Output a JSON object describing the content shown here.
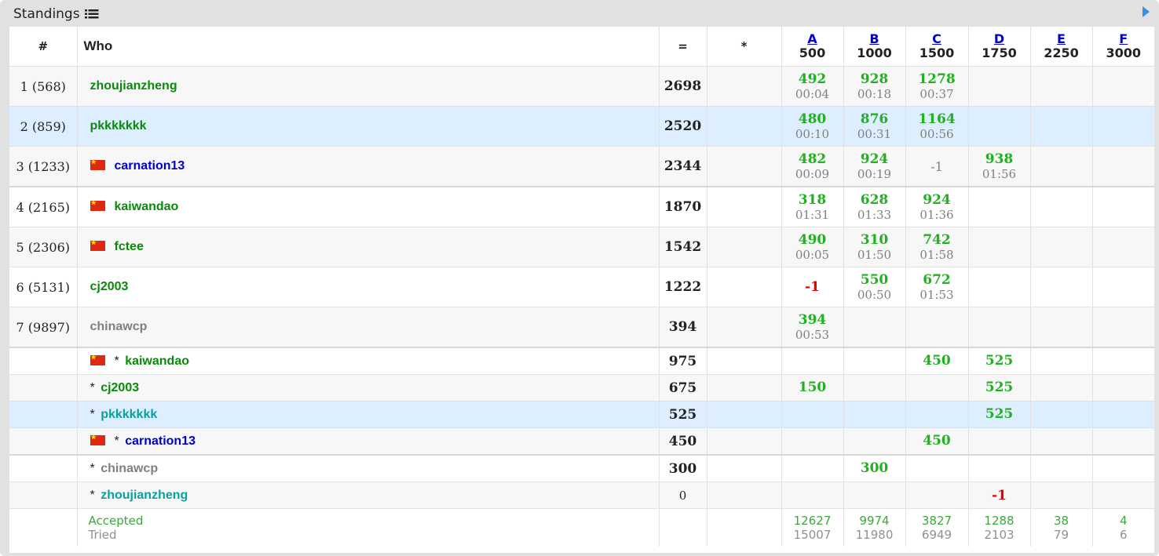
{
  "caption": {
    "title": "Standings"
  },
  "headers": {
    "rank": "#",
    "who": "Who",
    "points": "=",
    "penalty": "*"
  },
  "problems": [
    {
      "letter": "A",
      "value": "500"
    },
    {
      "letter": "B",
      "value": "1000"
    },
    {
      "letter": "C",
      "value": "1500"
    },
    {
      "letter": "D",
      "value": "1750"
    },
    {
      "letter": "E",
      "value": "2250"
    },
    {
      "letter": "F",
      "value": "3000"
    }
  ],
  "rows": [
    {
      "rank": "1 (568)",
      "who": "zhoujianzheng",
      "color": "green",
      "flag": false,
      "points": "2698",
      "virtual": false,
      "hl": false,
      "cells": [
        {
          "score": "492",
          "time": "00:04"
        },
        {
          "score": "928",
          "time": "00:18"
        },
        {
          "score": "1278",
          "time": "00:37"
        },
        null,
        null,
        null
      ]
    },
    {
      "rank": "2 (859)",
      "who": "pkkkkkkk",
      "color": "green",
      "flag": false,
      "points": "2520",
      "virtual": false,
      "hl": true,
      "cells": [
        {
          "score": "480",
          "time": "00:10"
        },
        {
          "score": "876",
          "time": "00:31"
        },
        {
          "score": "1164",
          "time": "00:56"
        },
        null,
        null,
        null
      ]
    },
    {
      "rank": "3 (1233)",
      "who": "carnation13",
      "color": "blue",
      "flag": true,
      "points": "2344",
      "virtual": false,
      "hl": false,
      "cells": [
        {
          "score": "482",
          "time": "00:09"
        },
        {
          "score": "924",
          "time": "00:19"
        },
        {
          "neg": "-1"
        },
        {
          "score": "938",
          "time": "01:56"
        },
        null,
        null
      ]
    },
    {
      "rank": "4 (2165)",
      "who": "kaiwandao",
      "color": "green",
      "flag": true,
      "points": "1870",
      "virtual": false,
      "hl": false,
      "cells": [
        {
          "score": "318",
          "time": "01:31"
        },
        {
          "score": "628",
          "time": "01:33"
        },
        {
          "score": "924",
          "time": "01:36"
        },
        null,
        null,
        null
      ]
    },
    {
      "rank": "5 (2306)",
      "who": "fctee",
      "color": "green",
      "flag": true,
      "points": "1542",
      "virtual": false,
      "hl": false,
      "cells": [
        {
          "score": "490",
          "time": "00:05"
        },
        {
          "score": "310",
          "time": "01:50"
        },
        {
          "score": "742",
          "time": "01:58"
        },
        null,
        null,
        null
      ]
    },
    {
      "rank": "6 (5131)",
      "who": "cj2003",
      "color": "green",
      "flag": false,
      "points": "1222",
      "virtual": false,
      "hl": false,
      "cells": [
        {
          "negred": "-1"
        },
        {
          "score": "550",
          "time": "00:50"
        },
        {
          "score": "672",
          "time": "01:53"
        },
        null,
        null,
        null
      ]
    },
    {
      "rank": "7 (9897)",
      "who": "chinawcp",
      "color": "gray",
      "flag": false,
      "points": "394",
      "virtual": false,
      "hl": false,
      "cells": [
        {
          "score": "394",
          "time": "00:53"
        },
        null,
        null,
        null,
        null,
        null
      ]
    },
    {
      "rank": "",
      "who": "kaiwandao",
      "color": "green",
      "flag": true,
      "points": "975",
      "virtual": true,
      "hl": false,
      "cells": [
        null,
        null,
        {
          "score": "450"
        },
        {
          "score": "525"
        },
        null,
        null
      ]
    },
    {
      "rank": "",
      "who": "cj2003",
      "color": "green",
      "flag": false,
      "points": "675",
      "virtual": true,
      "hl": false,
      "cells": [
        {
          "score": "150"
        },
        null,
        null,
        {
          "score": "525"
        },
        null,
        null
      ]
    },
    {
      "rank": "",
      "who": "pkkkkkkk",
      "color": "teal",
      "flag": false,
      "points": "525",
      "virtual": true,
      "hl": true,
      "cells": [
        null,
        null,
        null,
        {
          "score": "525"
        },
        null,
        null
      ]
    },
    {
      "rank": "",
      "who": "carnation13",
      "color": "blue",
      "flag": true,
      "points": "450",
      "virtual": true,
      "hl": false,
      "cells": [
        null,
        null,
        {
          "score": "450"
        },
        null,
        null,
        null
      ]
    },
    {
      "rank": "",
      "who": "chinawcp",
      "color": "gray",
      "flag": false,
      "points": "300",
      "virtual": true,
      "hl": false,
      "cells": [
        null,
        {
          "score": "300"
        },
        null,
        null,
        null,
        null
      ]
    },
    {
      "rank": "",
      "who": "zhoujianzheng",
      "color": "teal",
      "flag": false,
      "points": "0",
      "virtual": true,
      "hl": false,
      "cells": [
        null,
        null,
        null,
        {
          "negred": "-1"
        },
        null,
        null
      ]
    }
  ],
  "summary": {
    "accepted_label": "Accepted",
    "tried_label": "Tried",
    "accepted": [
      "12627",
      "9974",
      "3827",
      "1288",
      "38",
      "4"
    ],
    "tried": [
      "15007",
      "11980",
      "6949",
      "2103",
      "79",
      "6"
    ]
  },
  "virtual_mark": "*",
  "colors": {
    "accepted": "#20b020",
    "rejected": "#e00000",
    "highlight": "#ddeeff",
    "link": "#0000cc"
  }
}
